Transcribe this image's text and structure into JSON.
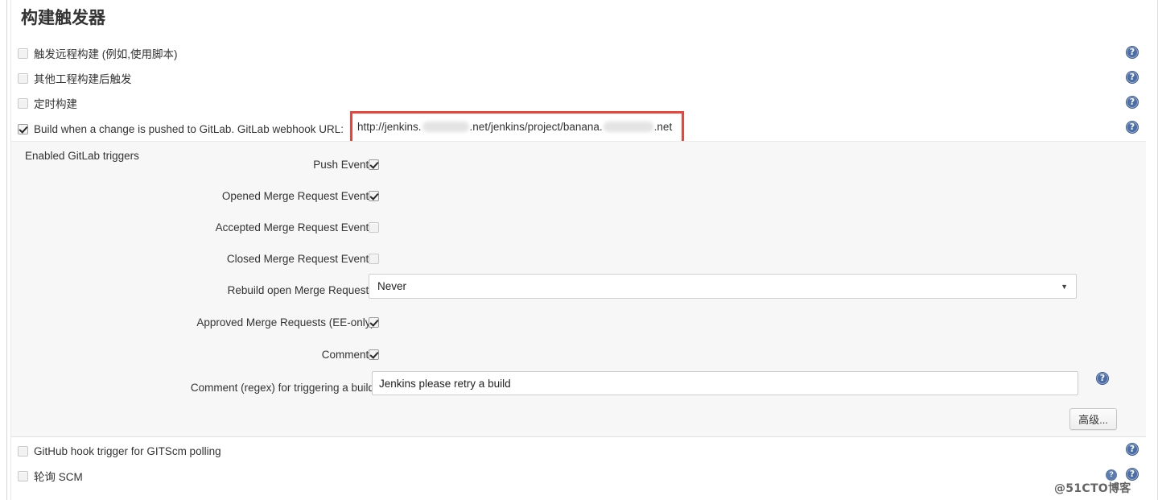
{
  "section": {
    "title": "构建触发器"
  },
  "top_triggers": [
    {
      "label": "触发远程构建 (例如,使用脚本)",
      "checked": false,
      "name": "trigger-remote-build"
    },
    {
      "label": "其他工程构建后触发",
      "checked": false,
      "name": "trigger-after-other-projects"
    },
    {
      "label": "定时构建",
      "checked": false,
      "name": "trigger-build-periodically"
    },
    {
      "label": "Build when a change is pushed to GitLab. GitLab webhook URL:",
      "checked": true,
      "name": "trigger-gitlab-push"
    }
  ],
  "webhook_url": {
    "prefix": "http://jenkins.",
    "middle": ".net/jenkins/project/banana.",
    "suffix": ".net",
    "redacted_1": "",
    "redacted_2": ""
  },
  "gitlab_section": {
    "label": "Enabled GitLab triggers",
    "rows": [
      {
        "label": "Push Events",
        "type": "checkbox",
        "checked": true,
        "name": "push-events"
      },
      {
        "label": "Opened Merge Request Events",
        "type": "checkbox",
        "checked": true,
        "name": "opened-merge-request-events"
      },
      {
        "label": "Accepted Merge Request Events",
        "type": "checkbox",
        "checked": false,
        "name": "accepted-merge-request-events"
      },
      {
        "label": "Closed Merge Request Events",
        "type": "checkbox",
        "checked": false,
        "name": "closed-merge-request-events"
      },
      {
        "label": "Rebuild open Merge Requests",
        "type": "select",
        "value": "Never",
        "name": "rebuild-open-merge-requests"
      },
      {
        "label": "Approved Merge Requests (EE-only)",
        "type": "checkbox",
        "checked": true,
        "name": "approved-merge-requests"
      },
      {
        "label": "Comments",
        "type": "checkbox",
        "checked": true,
        "name": "comments"
      },
      {
        "label": "Comment (regex) for triggering a build",
        "type": "text",
        "value": "Jenkins please retry a build",
        "name": "comment-regex"
      }
    ],
    "advanced_button": "高级..."
  },
  "bottom_triggers": [
    {
      "label": "GitHub hook trigger for GITScm polling",
      "checked": false,
      "name": "github-hook-trigger"
    },
    {
      "label": "轮询 SCM",
      "checked": false,
      "name": "poll-scm"
    }
  ],
  "help_icon_glyph": "?",
  "select_caret_glyph": "▼",
  "watermark": {
    "text": "@51CTO博客",
    "mark": "?"
  },
  "colors": {
    "annotation_red": "#e8453c",
    "help_blue": "#4b6ea8",
    "panel_gray": "#f7f7f7"
  }
}
